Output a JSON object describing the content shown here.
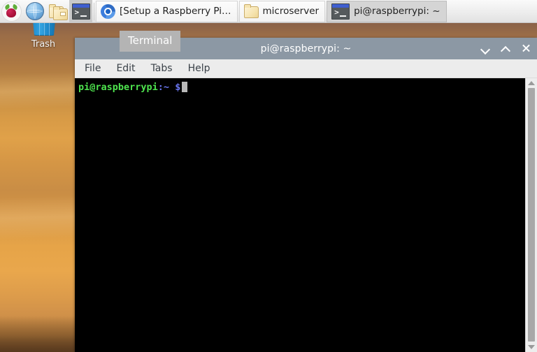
{
  "taskbar": {
    "launchers": [
      {
        "name": "menu-button",
        "icon": "raspberry-icon",
        "label": ""
      },
      {
        "name": "browser-launcher",
        "icon": "globe-icon",
        "label": ""
      },
      {
        "name": "file-manager-launcher",
        "icon": "folder-icon",
        "label": ""
      },
      {
        "name": "terminal-launcher",
        "icon": "terminal-icon",
        "label": ""
      }
    ],
    "windows": [
      {
        "label": "[Setup a Raspberry Pi…",
        "icon": "chromium-icon",
        "state": "raised"
      },
      {
        "label": "microserver",
        "icon": "folder-icon",
        "state": "raised"
      },
      {
        "label": "pi@raspberrypi: ~",
        "icon": "terminal-icon",
        "state": "pressed"
      }
    ]
  },
  "desktop": {
    "icons": [
      {
        "label": "Trash",
        "icon": "trash-icon"
      }
    ]
  },
  "tooltip": {
    "text": "Terminal"
  },
  "terminal": {
    "title": "pi@raspberrypi: ~",
    "window_buttons": {
      "minimize": "chevron-down-icon",
      "maximize": "chevron-up-icon",
      "close": "close-icon"
    },
    "menu": [
      "File",
      "Edit",
      "Tabs",
      "Help"
    ],
    "prompt": {
      "user_host": "pi@raspberrypi",
      "path": ":~",
      "symbol": "$"
    },
    "colors": {
      "background": "#000000",
      "user_host": "#4ee44e",
      "path": "#6a76f0",
      "titlebar": "#8c98a4",
      "menubar": "#ececec",
      "cursor": "#b9b9b9"
    }
  }
}
